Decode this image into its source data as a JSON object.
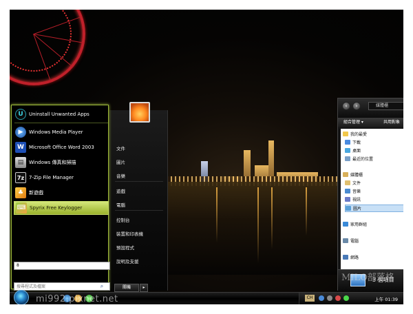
{
  "start_menu": {
    "programs": [
      {
        "label": "Uninstall Unwanted Apps",
        "icon": "uninstall-icon"
      },
      {
        "label": "Windows Media Player",
        "icon": "media-player-icon"
      },
      {
        "label": "Microsoft Office Word 2003",
        "icon": "word-icon"
      },
      {
        "label": "Windows 傳真和掃描",
        "icon": "fax-scan-icon"
      },
      {
        "label": "7-Zip File Manager",
        "icon": "7zip-icon"
      },
      {
        "label": "新遊戲",
        "icon": "new-games-icon"
      },
      {
        "label": "Spyrix Free Keylogger",
        "icon": "keylogger-icon"
      }
    ],
    "small_input_value": "8",
    "search_placeholder": "搜尋程式及檔案",
    "right_items": [
      "文件",
      "圖片",
      "音樂",
      "遊戲",
      "電腦",
      "控制台",
      "裝置和印表機",
      "預設程式",
      "說明及支援"
    ],
    "right_top_item": "",
    "lock_label": "關機",
    "arrow_label": "▸"
  },
  "explorer": {
    "address": "媒體櫃",
    "toolbar_organize": "組合管理 ▾",
    "toolbar_share": "共用對象",
    "nav_items": [
      {
        "label": "我的最愛",
        "color": "#f2c84b"
      },
      {
        "label": "下載",
        "color": "#4a8be0"
      },
      {
        "label": "桌面",
        "color": "#4aa8e0"
      },
      {
        "label": "最近的位置",
        "color": "#7aa0c8"
      },
      {
        "label": "媒體櫃",
        "color": "#d8b05a"
      },
      {
        "label": "文件",
        "color": "#e0c070"
      },
      {
        "label": "音樂",
        "color": "#4a8bd0"
      },
      {
        "label": "視訊",
        "color": "#6a7ac8"
      },
      {
        "label": "圖片",
        "color": "#5aa0d8"
      },
      {
        "label": "家用群組",
        "color": "#3a8ad8"
      },
      {
        "label": "電腦",
        "color": "#6a8aa8"
      },
      {
        "label": "網路",
        "color": "#4a7ab8"
      }
    ],
    "status_count": "3 個項目"
  },
  "taskbar": {
    "watermark": "mi992.pixnet.net",
    "lang": "CH",
    "clock": "上午 01:39",
    "milo_mark": "MILO部落格"
  }
}
